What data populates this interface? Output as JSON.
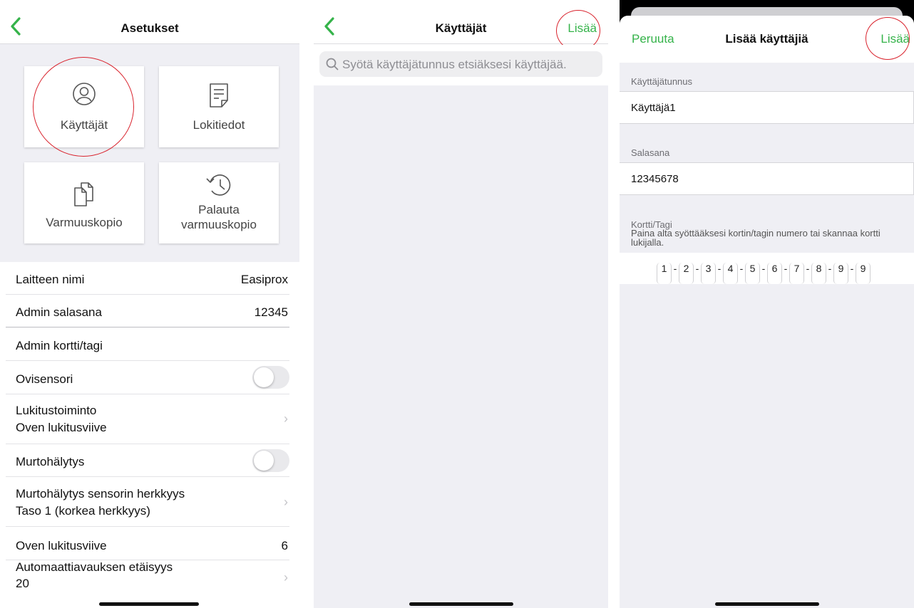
{
  "settings": {
    "title": "Asetukset",
    "tiles": [
      {
        "label": "Käyttäjät",
        "icon": "user-circle-icon"
      },
      {
        "label": "Lokitiedot",
        "icon": "document-icon"
      },
      {
        "label": "Varmuuskopio",
        "icon": "copy-icon"
      },
      {
        "label": "Palauta",
        "label2": "varmuuskopio",
        "icon": "history-icon"
      }
    ],
    "rows": {
      "device_name": {
        "label": "Laitteen nimi",
        "value": "Easiprox"
      },
      "admin_password": {
        "label": "Admin salasana",
        "value": "12345"
      },
      "admin_card": {
        "label": "Admin kortti/tagi"
      },
      "door_sensor": {
        "label": "Ovisensori",
        "on": false
      },
      "lock_function": {
        "label": "Lukitustoiminto",
        "sub": "Oven lukitusviive"
      },
      "burglar_alarm": {
        "label": "Murtohälytys",
        "on": false
      },
      "sensor_sensitivity": {
        "label": "Murtohälytys sensorin herkkyys",
        "sub": "Taso 1 (korkea herkkyys)"
      },
      "lock_delay": {
        "label": "Oven lukitusviive",
        "value": "6"
      },
      "auto_open": {
        "label": "Automaattiavauksen etäisyys",
        "sub": "20"
      }
    }
  },
  "users": {
    "title": "Käyttäjät",
    "add_label": "Lisää",
    "search_placeholder": "Syötä käyttäjätunnus etsiäksesi käyttäjää."
  },
  "add_user": {
    "cancel_label": "Peruuta",
    "title": "Lisää käyttäjiä",
    "add_label": "Lisää",
    "username_label": "Käyttäjätunnus",
    "username_value": "Käyttäjä1",
    "password_label": "Salasana",
    "password_value": "12345678",
    "card_label": "Kortti/Tagi",
    "card_hint": "Paina alta syöttääksesi kortin/tagin numero tai skannaa kortti lukijalla.",
    "digits": [
      "1",
      "2",
      "3",
      "4",
      "5",
      "6",
      "7",
      "8",
      "9",
      "9"
    ]
  },
  "colors": {
    "accent": "#35b34a",
    "annotation": "#d9232d",
    "background": "#efeff4"
  }
}
